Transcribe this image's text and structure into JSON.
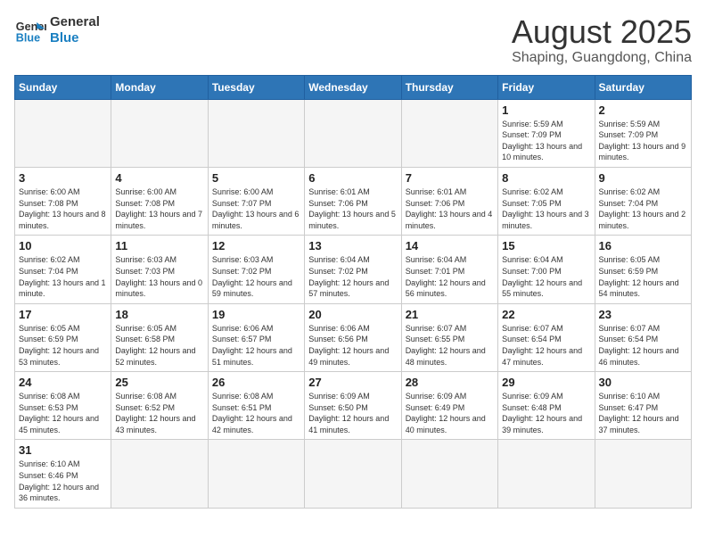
{
  "header": {
    "logo_general": "General",
    "logo_blue": "Blue",
    "month_title": "August 2025",
    "subtitle": "Shaping, Guangdong, China"
  },
  "days_of_week": [
    "Sunday",
    "Monday",
    "Tuesday",
    "Wednesday",
    "Thursday",
    "Friday",
    "Saturday"
  ],
  "weeks": [
    [
      {
        "day": "",
        "info": ""
      },
      {
        "day": "",
        "info": ""
      },
      {
        "day": "",
        "info": ""
      },
      {
        "day": "",
        "info": ""
      },
      {
        "day": "",
        "info": ""
      },
      {
        "day": "1",
        "info": "Sunrise: 5:59 AM\nSunset: 7:09 PM\nDaylight: 13 hours and 10 minutes."
      },
      {
        "day": "2",
        "info": "Sunrise: 5:59 AM\nSunset: 7:09 PM\nDaylight: 13 hours and 9 minutes."
      }
    ],
    [
      {
        "day": "3",
        "info": "Sunrise: 6:00 AM\nSunset: 7:08 PM\nDaylight: 13 hours and 8 minutes."
      },
      {
        "day": "4",
        "info": "Sunrise: 6:00 AM\nSunset: 7:08 PM\nDaylight: 13 hours and 7 minutes."
      },
      {
        "day": "5",
        "info": "Sunrise: 6:00 AM\nSunset: 7:07 PM\nDaylight: 13 hours and 6 minutes."
      },
      {
        "day": "6",
        "info": "Sunrise: 6:01 AM\nSunset: 7:06 PM\nDaylight: 13 hours and 5 minutes."
      },
      {
        "day": "7",
        "info": "Sunrise: 6:01 AM\nSunset: 7:06 PM\nDaylight: 13 hours and 4 minutes."
      },
      {
        "day": "8",
        "info": "Sunrise: 6:02 AM\nSunset: 7:05 PM\nDaylight: 13 hours and 3 minutes."
      },
      {
        "day": "9",
        "info": "Sunrise: 6:02 AM\nSunset: 7:04 PM\nDaylight: 13 hours and 2 minutes."
      }
    ],
    [
      {
        "day": "10",
        "info": "Sunrise: 6:02 AM\nSunset: 7:04 PM\nDaylight: 13 hours and 1 minute."
      },
      {
        "day": "11",
        "info": "Sunrise: 6:03 AM\nSunset: 7:03 PM\nDaylight: 13 hours and 0 minutes."
      },
      {
        "day": "12",
        "info": "Sunrise: 6:03 AM\nSunset: 7:02 PM\nDaylight: 12 hours and 59 minutes."
      },
      {
        "day": "13",
        "info": "Sunrise: 6:04 AM\nSunset: 7:02 PM\nDaylight: 12 hours and 57 minutes."
      },
      {
        "day": "14",
        "info": "Sunrise: 6:04 AM\nSunset: 7:01 PM\nDaylight: 12 hours and 56 minutes."
      },
      {
        "day": "15",
        "info": "Sunrise: 6:04 AM\nSunset: 7:00 PM\nDaylight: 12 hours and 55 minutes."
      },
      {
        "day": "16",
        "info": "Sunrise: 6:05 AM\nSunset: 6:59 PM\nDaylight: 12 hours and 54 minutes."
      }
    ],
    [
      {
        "day": "17",
        "info": "Sunrise: 6:05 AM\nSunset: 6:59 PM\nDaylight: 12 hours and 53 minutes."
      },
      {
        "day": "18",
        "info": "Sunrise: 6:05 AM\nSunset: 6:58 PM\nDaylight: 12 hours and 52 minutes."
      },
      {
        "day": "19",
        "info": "Sunrise: 6:06 AM\nSunset: 6:57 PM\nDaylight: 12 hours and 51 minutes."
      },
      {
        "day": "20",
        "info": "Sunrise: 6:06 AM\nSunset: 6:56 PM\nDaylight: 12 hours and 49 minutes."
      },
      {
        "day": "21",
        "info": "Sunrise: 6:07 AM\nSunset: 6:55 PM\nDaylight: 12 hours and 48 minutes."
      },
      {
        "day": "22",
        "info": "Sunrise: 6:07 AM\nSunset: 6:54 PM\nDaylight: 12 hours and 47 minutes."
      },
      {
        "day": "23",
        "info": "Sunrise: 6:07 AM\nSunset: 6:54 PM\nDaylight: 12 hours and 46 minutes."
      }
    ],
    [
      {
        "day": "24",
        "info": "Sunrise: 6:08 AM\nSunset: 6:53 PM\nDaylight: 12 hours and 45 minutes."
      },
      {
        "day": "25",
        "info": "Sunrise: 6:08 AM\nSunset: 6:52 PM\nDaylight: 12 hours and 43 minutes."
      },
      {
        "day": "26",
        "info": "Sunrise: 6:08 AM\nSunset: 6:51 PM\nDaylight: 12 hours and 42 minutes."
      },
      {
        "day": "27",
        "info": "Sunrise: 6:09 AM\nSunset: 6:50 PM\nDaylight: 12 hours and 41 minutes."
      },
      {
        "day": "28",
        "info": "Sunrise: 6:09 AM\nSunset: 6:49 PM\nDaylight: 12 hours and 40 minutes."
      },
      {
        "day": "29",
        "info": "Sunrise: 6:09 AM\nSunset: 6:48 PM\nDaylight: 12 hours and 39 minutes."
      },
      {
        "day": "30",
        "info": "Sunrise: 6:10 AM\nSunset: 6:47 PM\nDaylight: 12 hours and 37 minutes."
      }
    ],
    [
      {
        "day": "31",
        "info": "Sunrise: 6:10 AM\nSunset: 6:46 PM\nDaylight: 12 hours and 36 minutes."
      },
      {
        "day": "",
        "info": ""
      },
      {
        "day": "",
        "info": ""
      },
      {
        "day": "",
        "info": ""
      },
      {
        "day": "",
        "info": ""
      },
      {
        "day": "",
        "info": ""
      },
      {
        "day": "",
        "info": ""
      }
    ]
  ]
}
